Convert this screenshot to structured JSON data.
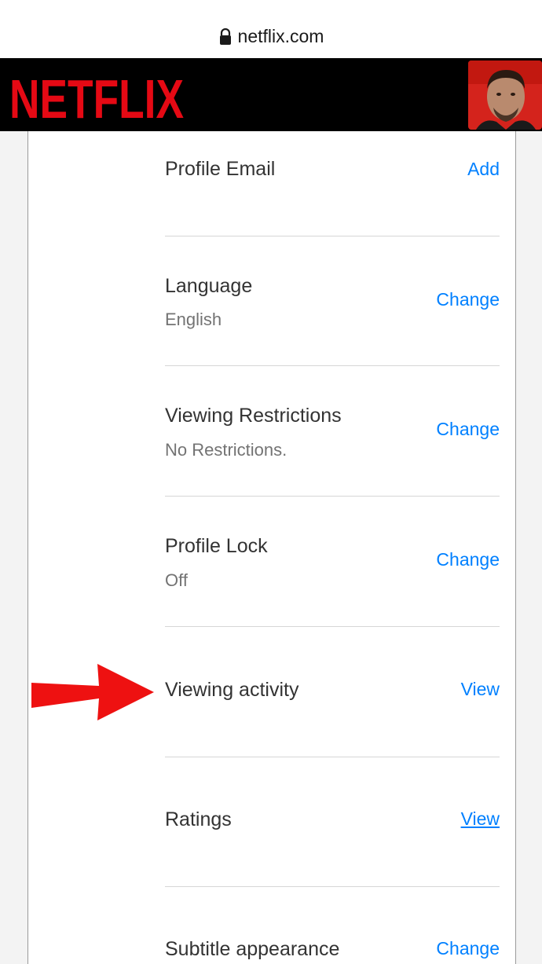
{
  "browser": {
    "url": "netflix.com"
  },
  "header": {
    "brand": "NETFLIX",
    "avatar": "profile-avatar"
  },
  "settings": [
    {
      "title": "Profile Email",
      "subtitle": "",
      "action": "Add"
    },
    {
      "title": "Language",
      "subtitle": "English",
      "action": "Change"
    },
    {
      "title": "Viewing Restrictions",
      "subtitle": "No Restrictions.",
      "action": "Change"
    },
    {
      "title": "Profile Lock",
      "subtitle": "Off",
      "action": "Change"
    },
    {
      "title": "Viewing activity",
      "subtitle": "",
      "action": "View"
    },
    {
      "title": "Ratings",
      "subtitle": "",
      "action": "View"
    },
    {
      "title": "Subtitle appearance",
      "subtitle": "",
      "action": "Change"
    }
  ],
  "colors": {
    "brand": "#e50914",
    "link": "#0080ff",
    "arrow": "#ee1111"
  }
}
